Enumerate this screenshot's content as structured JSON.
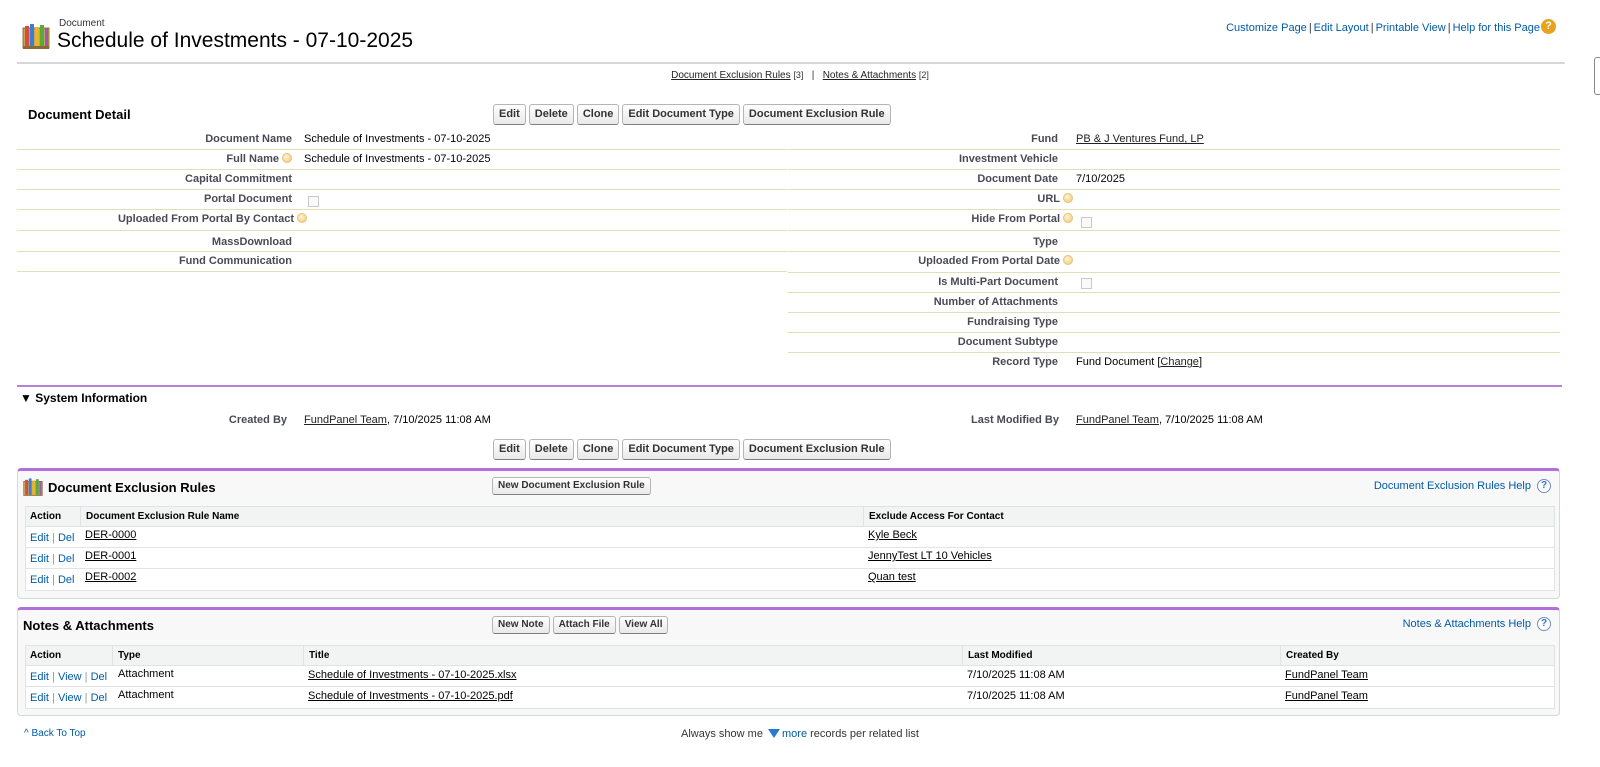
{
  "header": {
    "object_type": "Document",
    "title": "Schedule of Investments - 07-10-2025",
    "links": [
      "Customize Page",
      "Edit Layout",
      "Printable View",
      "Help for this Page"
    ],
    "help_icon": "?"
  },
  "related_links": {
    "exclusion": "Document Exclusion Rules",
    "exclusion_count": "[3]",
    "separator": "|",
    "notes": "Notes & Attachments",
    "notes_count": "[2]"
  },
  "detail": {
    "title": "Document Detail",
    "buttons": [
      "Edit",
      "Delete",
      "Clone",
      "Edit Document Type",
      "Document Exclusion Rule"
    ],
    "left_fields": [
      {
        "label": "Document Name",
        "value": "Schedule of Investments - 07-10-2025"
      },
      {
        "label": "Full Name",
        "value": "Schedule of Investments - 07-10-2025"
      },
      {
        "label": "Capital Commitment",
        "value": ""
      },
      {
        "label": "Portal Document",
        "value": ""
      },
      {
        "label": "Uploaded From Portal By Contact",
        "value": ""
      },
      {
        "label": "MassDownload",
        "value": ""
      },
      {
        "label": "Fund Communication",
        "value": ""
      }
    ],
    "right_fields": [
      {
        "label": "Fund",
        "value": "PB & J Ventures Fund, LP"
      },
      {
        "label": "Investment Vehicle",
        "value": ""
      },
      {
        "label": "Document Date",
        "value": "7/10/2025"
      },
      {
        "label": "URL",
        "value": ""
      },
      {
        "label": "Hide From Portal",
        "value": ""
      },
      {
        "label": "Type",
        "value": ""
      },
      {
        "label": "Uploaded From Portal Date",
        "value": ""
      },
      {
        "label": "Is Multi-Part Document",
        "value": ""
      },
      {
        "label": "Number of Attachments",
        "value": ""
      },
      {
        "label": "Fundraising Type",
        "value": ""
      },
      {
        "label": "Document Subtype",
        "value": ""
      },
      {
        "label": "Record Type",
        "value": "Fund Document",
        "change_link": "Change",
        "open_bracket": " [",
        "close_bracket": "]"
      }
    ]
  },
  "system_info": {
    "title": "System Information",
    "created_by_label": "Created By",
    "created_by_user": "FundPanel Team",
    "created_by_date": ", 7/10/2025 11:08 AM",
    "modified_by_label": "Last Modified By",
    "modified_by_user": "FundPanel Team",
    "modified_by_date": ", 7/10/2025 11:08 AM"
  },
  "exclusion_rules": {
    "title": "Document Exclusion Rules",
    "new_button": "New Document Exclusion Rule",
    "help": "Document Exclusion Rules Help",
    "columns": [
      "Action",
      "Document Exclusion Rule Name",
      "Exclude Access For Contact"
    ],
    "rows": [
      {
        "edit": "Edit",
        "del": "Del",
        "name": "DER-0000",
        "contact": "Kyle Beck"
      },
      {
        "edit": "Edit",
        "del": "Del",
        "name": "DER-0001",
        "contact": "JennyTest LT 10 Vehicles"
      },
      {
        "edit": "Edit",
        "del": "Del",
        "name": "DER-0002",
        "contact": "Quan test"
      }
    ]
  },
  "notes": {
    "title": "Notes & Attachments",
    "buttons": [
      "New Note",
      "Attach File",
      "View All"
    ],
    "help": "Notes & Attachments Help",
    "columns": [
      "Action",
      "Type",
      "Title",
      "Last Modified",
      "Created By"
    ],
    "rows": [
      {
        "edit": "Edit",
        "view": "View",
        "del": "Del",
        "type": "Attachment",
        "title": "Schedule of Investments - 07-10-2025.xlsx",
        "modified": "7/10/2025 11:08 AM",
        "created_by": "FundPanel Team"
      },
      {
        "edit": "Edit",
        "view": "View",
        "del": "Del",
        "type": "Attachment",
        "title": "Schedule of Investments - 07-10-2025.pdf",
        "modified": "7/10/2025 11:08 AM",
        "created_by": "FundPanel Team"
      }
    ]
  },
  "footer": {
    "back_to_top": "Back To Top",
    "always_show": "Always show me",
    "more": "more",
    "records_text": "records per related list"
  },
  "colors": {
    "link": "#015ba7",
    "section_accent": "#b06fda",
    "help_icon": "#e8a21b"
  }
}
